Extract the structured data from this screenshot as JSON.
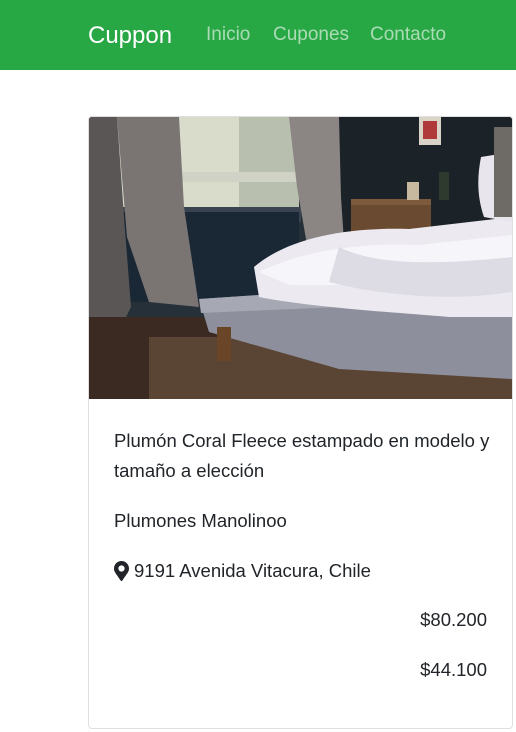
{
  "navbar": {
    "brand": "Cuppon",
    "links": [
      "Inicio",
      "Cupones",
      "Contacto"
    ],
    "color": "#28a745"
  },
  "product": {
    "image_alt": "Cama con plumón blanco junto a una ventana",
    "title": "Plumón Coral Fleece estampado en modelo y tamaño a elección",
    "store": "Plumones Manolinoo",
    "address_icon": "map-marker-icon",
    "address": "9191 Avenida Vitacura, Chile",
    "price_original": "$80.200",
    "price_deal": "$44.100"
  }
}
